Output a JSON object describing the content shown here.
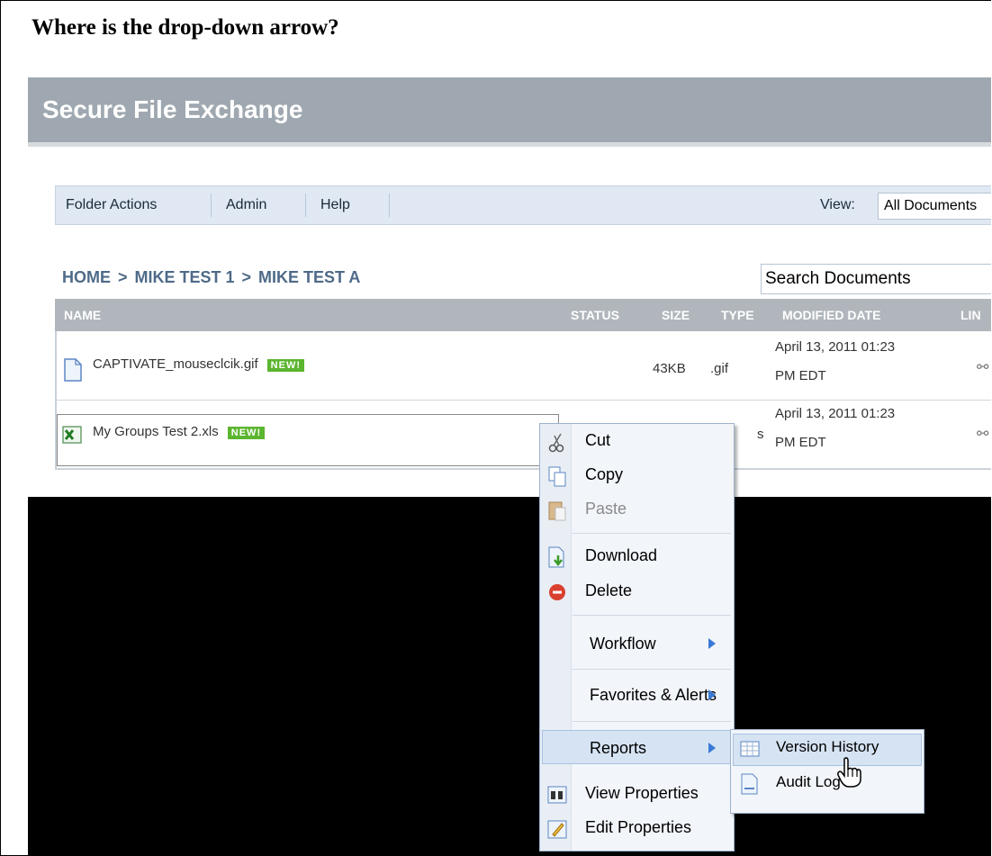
{
  "question": "Where is the drop-down arrow?",
  "app": {
    "title": "Secure File Exchange"
  },
  "menubar": {
    "items": [
      "Folder Actions",
      "Admin",
      "Help"
    ],
    "view_label": "View:",
    "view_value": "All Documents"
  },
  "breadcrumb": [
    "HOME",
    ">",
    "MIKE TEST 1",
    ">",
    "MIKE TEST A"
  ],
  "search": {
    "placeholder": "Search Documents"
  },
  "table": {
    "headers": [
      "NAME",
      "STATUS",
      "SIZE",
      "TYPE",
      "MODIFIED DATE",
      "LIN"
    ],
    "rows": [
      {
        "name": "CAPTIVATE_mouseclcik.gif",
        "badge": "NEW!",
        "size": "43KB",
        "type": ".gif",
        "date_line1": "April 13, 2011 01:23",
        "date_line2": "PM EDT",
        "icon": "document-icon"
      },
      {
        "name": "My Groups Test 2.xls",
        "badge": "NEW!",
        "size": "",
        "type": "s",
        "date_line1": "April 13, 2011 01:23",
        "date_line2": "PM EDT",
        "icon": "excel-icon"
      }
    ]
  },
  "context_menu": {
    "items": [
      {
        "label": "Cut",
        "icon": "scissors-icon"
      },
      {
        "label": "Copy",
        "icon": "copy-icon"
      },
      {
        "label": "Paste",
        "icon": "paste-icon",
        "disabled": true
      },
      {
        "label": "Download",
        "icon": "download-icon"
      },
      {
        "label": "Delete",
        "icon": "delete-icon"
      },
      {
        "label": "Workflow",
        "submenu": true
      },
      {
        "label": "Favorites & Alerts",
        "submenu": true
      },
      {
        "label": "Reports",
        "submenu": true,
        "highlighted": true
      },
      {
        "label": "View Properties",
        "icon": "binoculars-icon"
      },
      {
        "label": "Edit Properties",
        "icon": "edit-icon"
      }
    ]
  },
  "submenu": {
    "items": [
      {
        "label": "Version History",
        "icon": "table-icon",
        "highlighted": true
      },
      {
        "label": "Audit Log",
        "icon": "log-icon"
      }
    ]
  },
  "colors": {
    "header_bar": "#9fa8b0",
    "menubar": "#dfe8f3",
    "link": "#4f6a88",
    "badge": "#5bb52f",
    "highlight": "#d6e3f3"
  }
}
